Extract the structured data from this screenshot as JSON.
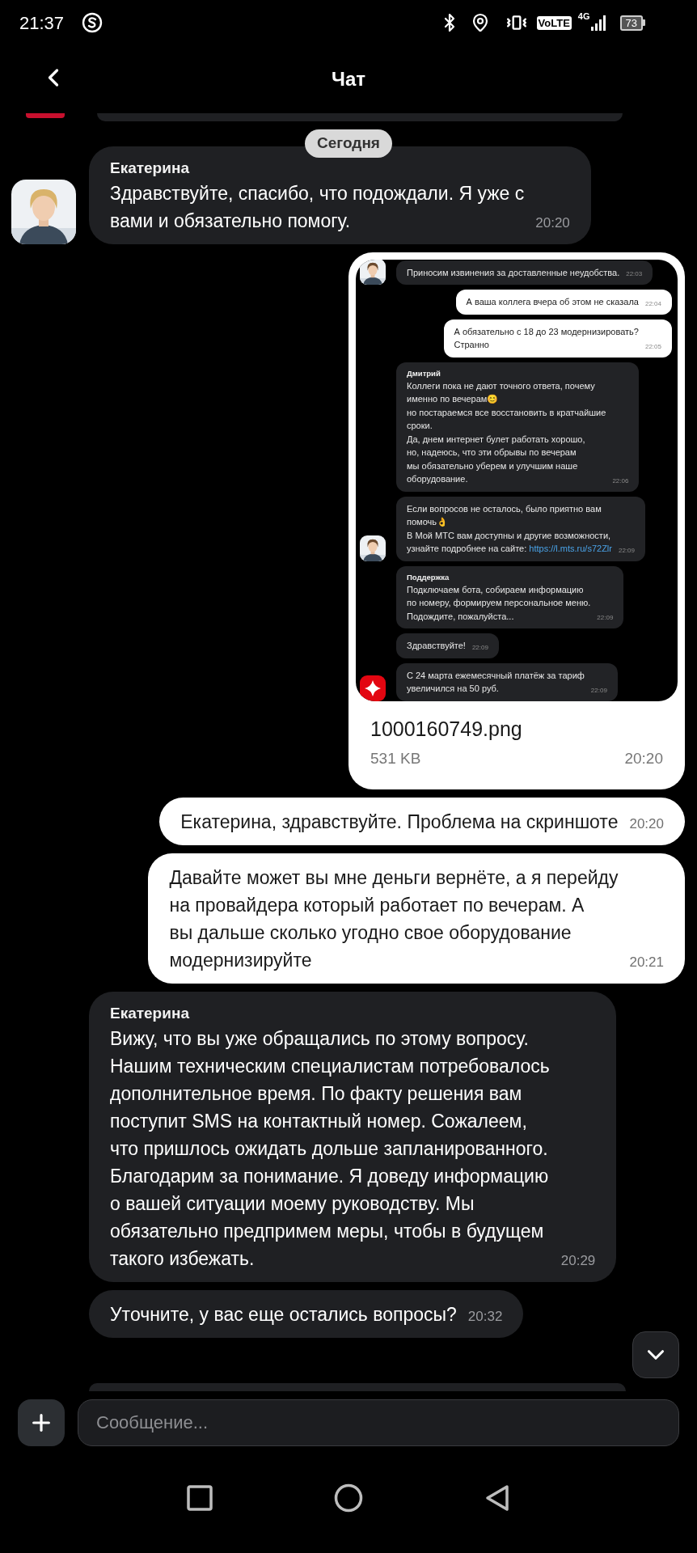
{
  "status_bar": {
    "time": "21:37",
    "network_badge": "VoLTE",
    "network_type": "4G",
    "battery": "73"
  },
  "header": {
    "title": "Чат"
  },
  "date_chip": "Сегодня",
  "messages": [
    {
      "kind": "incoming",
      "author": "Екатерина",
      "text": "Здравствуйте, спасибо, что подождали. Я уже с\nвами и обязательно помогу.",
      "time": "20:20"
    },
    {
      "kind": "attachment",
      "file_name": "1000160749.png",
      "file_size": "531 KB",
      "time": "20:20",
      "preview": [
        {
          "kind": "incoming",
          "text": "Приносим извинения за доставленные неудобства.",
          "time": "22:03"
        },
        {
          "kind": "outgoing",
          "text": "А ваша коллега вчера об этом не сказала",
          "time": "22:04"
        },
        {
          "kind": "outgoing",
          "text": "А обязательно с 18 до 23 модернизировать?\nСтранно",
          "time": "22:05"
        },
        {
          "kind": "incoming",
          "author": "Дмитрий",
          "text": "Коллеги пока не дают точного ответа, почему\nименно по вечерам😊\nно постараемся все восстановить в кратчайшие\nсроки.\nДа, днем интернет булет работать хорошо,\nно, надеюсь, что эти обрывы по вечерам\nмы обязательно уберем и улучшим наше\nоборудование.",
          "time": "22:06"
        },
        {
          "kind": "incoming",
          "text": "Если вопросов не осталось, было приятно вам\nпомочь👌\nВ Мой МТС вам доступны и другие возможности,\nузнайте подробнее на сайте: ",
          "link": "https://l.mts.ru/s72Zlr",
          "time": "22:09"
        },
        {
          "kind": "incoming",
          "author": "Поддержка",
          "text": "Подключаем бота, собираем информацию\nпо номеру, формируем персональное меню.\nПодождите, пожалуйста...",
          "time": "22:09"
        },
        {
          "kind": "incoming",
          "text": "Здравствуйте!",
          "time": "22:09"
        },
        {
          "kind": "incoming",
          "avatar": {
            "kind": "logo"
          },
          "text": "С 24 марта ежемесячный платёж за тариф\nувеличился на 50 руб.",
          "time": "22:09"
        }
      ]
    },
    {
      "kind": "outgoing",
      "text": "Екатерина, здравствуйте. Проблема на скриншоте",
      "time": "20:20"
    },
    {
      "kind": "outgoing",
      "text": "Давайте может вы мне деньги вернёте, а я перейду\nна провайдера который работает по вечерам. А\nвы дальше сколько угодно свое оборудование\nмодернизируйте",
      "time": "20:21"
    },
    {
      "kind": "incoming",
      "author": "Екатерина",
      "text": "Вижу, что вы уже обращались по этому вопросу.\nНашим техническим специалистам потребовалось\nдополнительное время. По факту решения вам\nпоступит SMS на контактный номер. Сожалеем,\nчто пришлось ожидать дольше запланированного.\nБлагодарим за понимание. Я доведу информацию\nо вашей ситуации моему руководству. Мы\nобязательно предпримем меры, чтобы в будущем\nтакого избежать.",
      "time": "20:29"
    },
    {
      "kind": "incoming",
      "text": "Уточните, у вас еще остались вопросы?",
      "time": "20:32"
    }
  ],
  "composer": {
    "placeholder": "Сообщение..."
  }
}
